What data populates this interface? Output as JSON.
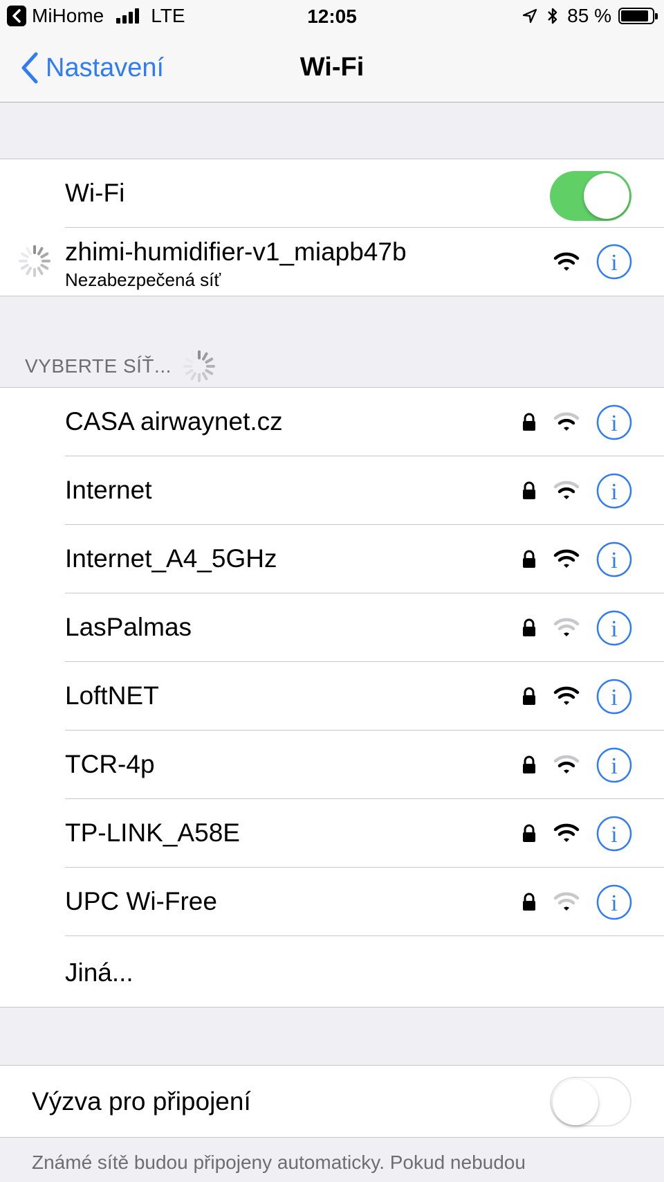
{
  "status_bar": {
    "carrier": "MiHome",
    "network": "LTE",
    "time": "12:05",
    "battery": "85 %"
  },
  "nav": {
    "back_label": "Nastavení",
    "title": "Wi-Fi"
  },
  "wifi_toggle": {
    "label": "Wi-Fi",
    "enabled": true
  },
  "connected_network": {
    "name": "zhimi-humidifier-v1_miapb47b",
    "subtitle": "Nezabezpečená síť"
  },
  "networks_header": "VYBERTE SÍŤ...",
  "networks": [
    {
      "name": "CASA airwaynet.cz",
      "locked": true,
      "signal": 2
    },
    {
      "name": "Internet",
      "locked": true,
      "signal": 2
    },
    {
      "name": "Internet_A4_5GHz",
      "locked": true,
      "signal": 3
    },
    {
      "name": "LasPalmas",
      "locked": true,
      "signal": 1
    },
    {
      "name": "LoftNET",
      "locked": true,
      "signal": 3
    },
    {
      "name": "TCR-4p",
      "locked": true,
      "signal": 2
    },
    {
      "name": "TP-LINK_A58E",
      "locked": true,
      "signal": 3
    },
    {
      "name": "UPC Wi-Free",
      "locked": true,
      "signal": 1
    }
  ],
  "other_label": "Jiná...",
  "ask_to_join": {
    "label": "Výzva pro připojení",
    "enabled": false
  },
  "footer": "Známé sítě budou připojeny automaticky. Pokud nebudou",
  "colors": {
    "accent": "#2f7cf6",
    "toggle_on": "#5fcf66"
  }
}
